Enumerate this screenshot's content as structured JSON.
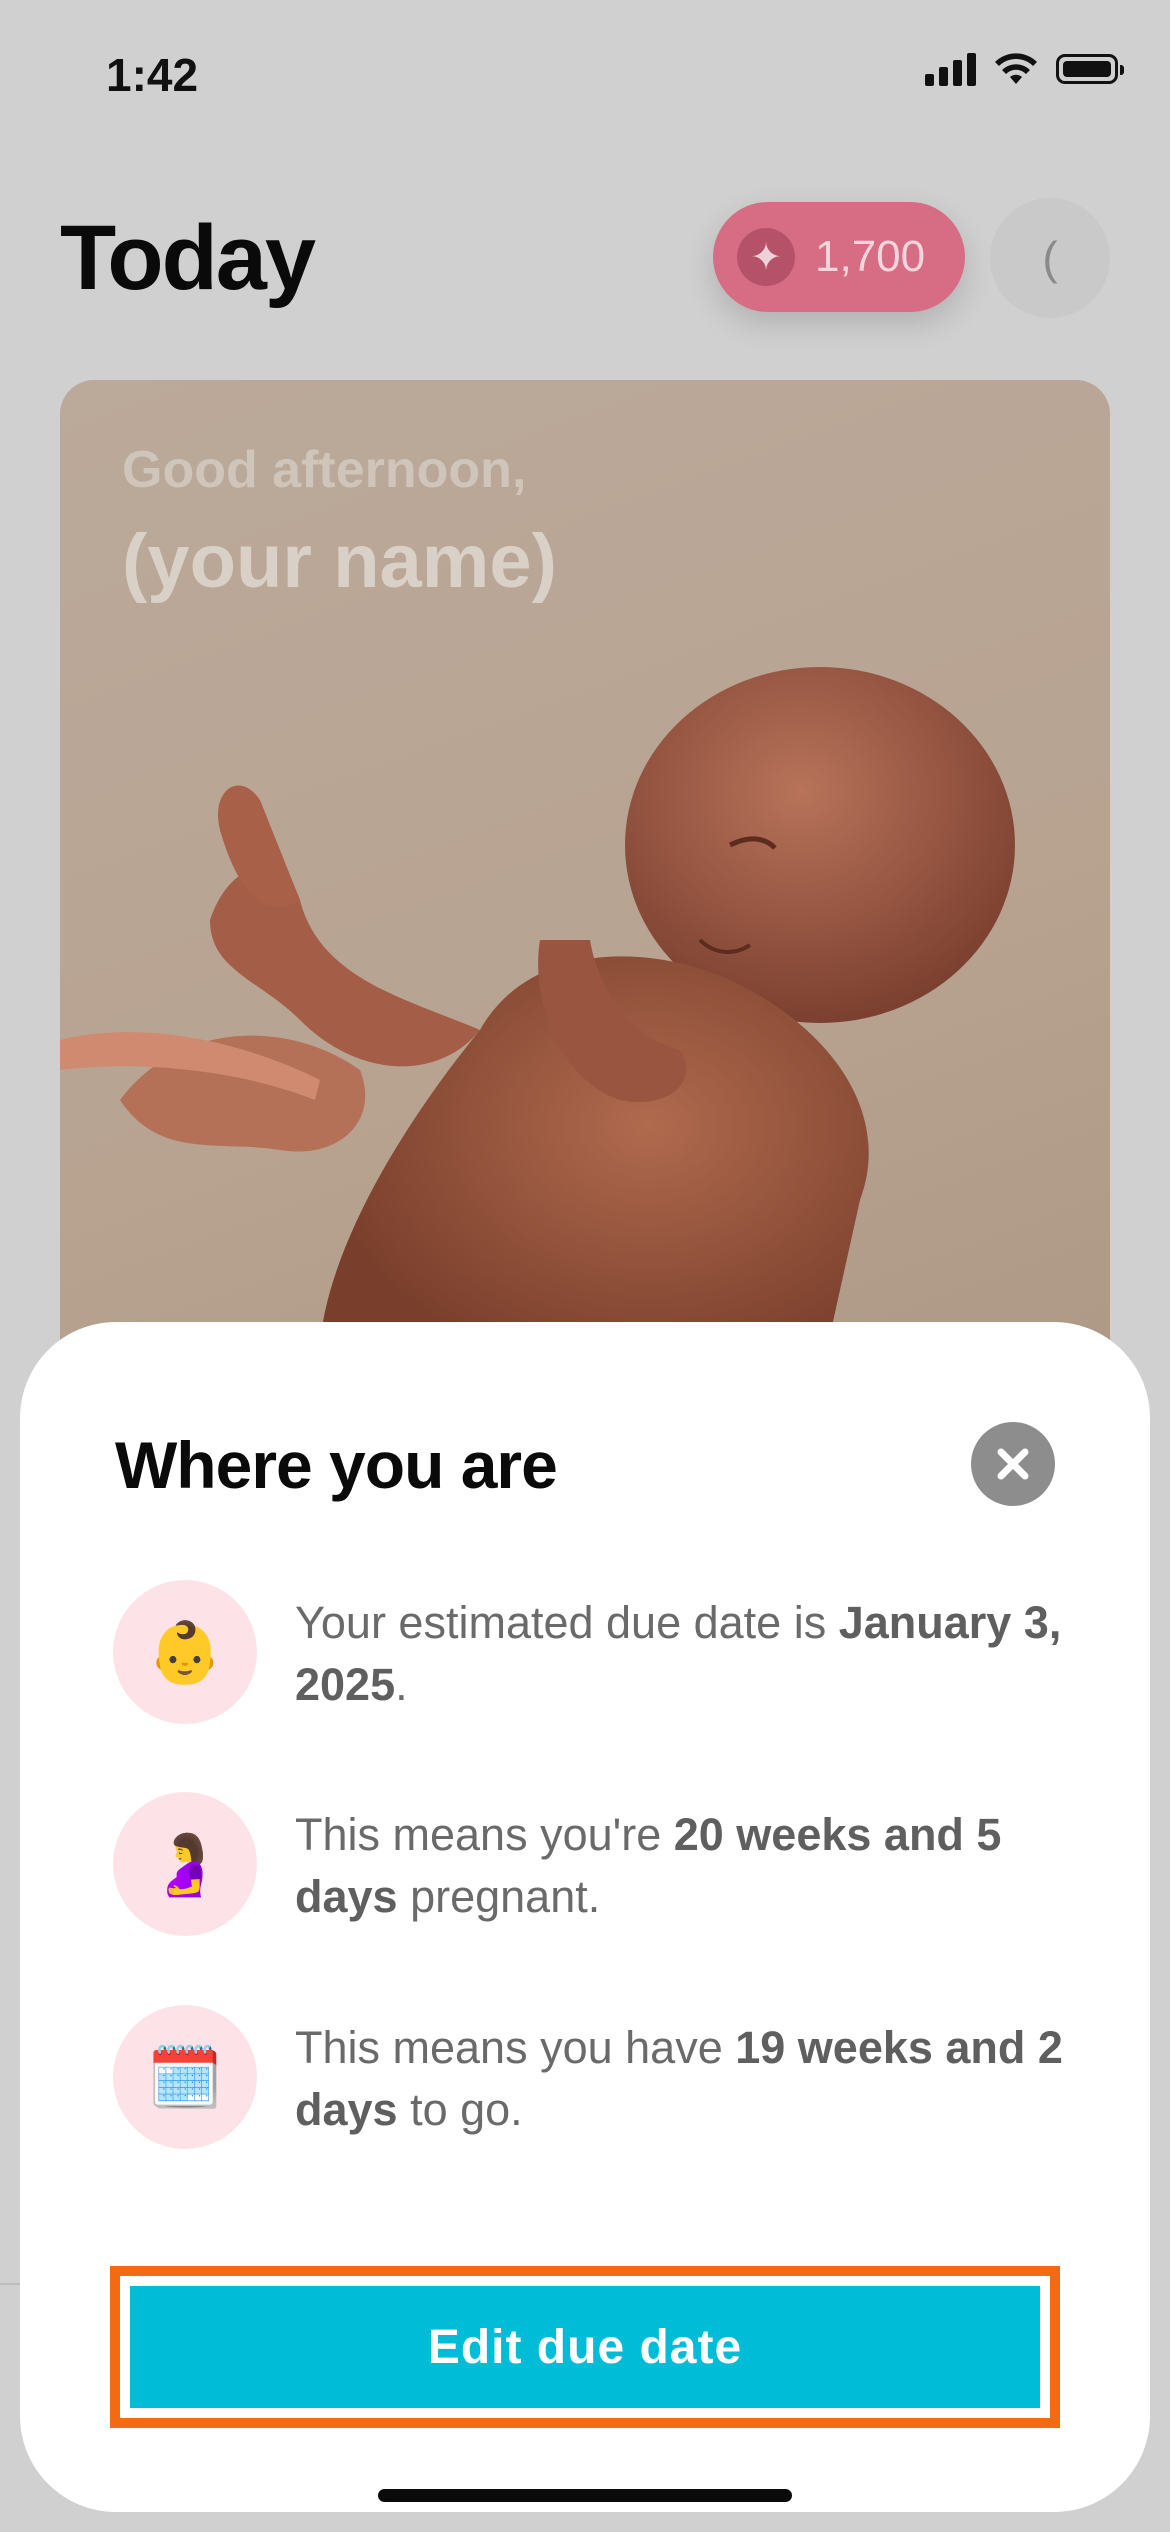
{
  "status_bar": {
    "time": "1:42"
  },
  "header": {
    "title": "Today",
    "points": "1,700",
    "avatar_initial": "("
  },
  "hero": {
    "greeting": "Good afternoon,",
    "name": "(your name)"
  },
  "sheet": {
    "title": "Where you are",
    "rows": [
      {
        "icon": "baby-icon",
        "glyph": "👶",
        "pre": "Your estimated due date is ",
        "bold": "January 3, 2025",
        "post": "."
      },
      {
        "icon": "pregnant-woman-icon",
        "glyph": "🤰",
        "pre": "This means you're ",
        "bold": "20 weeks and 5 days",
        "post": " pregnant."
      },
      {
        "icon": "calendar-icon",
        "glyph": "🗓️",
        "pre": "This means you have ",
        "bold": "19 weeks and 2 days",
        "post": " to go."
      }
    ],
    "edit_label": "Edit due date"
  },
  "colors": {
    "accent_button": "#00bcd6",
    "highlight_outline": "#f26b14",
    "points_pill": "#d66d84"
  }
}
